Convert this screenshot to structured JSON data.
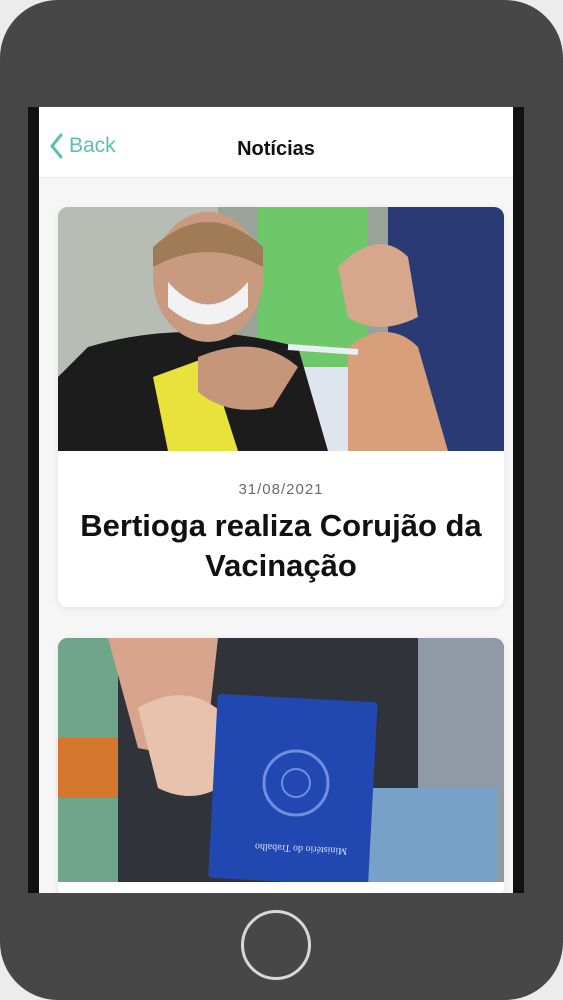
{
  "navbar": {
    "back_label": "Back",
    "title": "Notícias"
  },
  "news": [
    {
      "date": "31/08/2021",
      "title": "Bertioga realiza Corujão da Vacinação",
      "image": "vaccination-photo"
    },
    {
      "image": "work-card-photo",
      "image_text": "Ministério do Trabalho"
    }
  ],
  "colors": {
    "accent": "#5cc0b0",
    "device": "#474747"
  }
}
